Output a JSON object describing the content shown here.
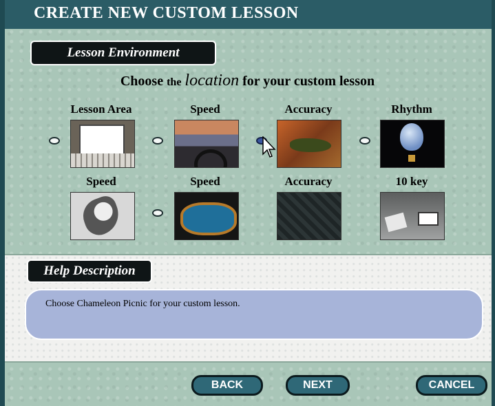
{
  "window": {
    "title": "CREATE NEW CUSTOM LESSON"
  },
  "lesson_environment": {
    "section_label": "Lesson Environment",
    "prompt": {
      "before": "Choose",
      "small": "the",
      "emphasis": "location",
      "after": "for your custom lesson"
    },
    "options": [
      {
        "label": "Lesson Area",
        "thumbnail": "classroom-computer",
        "radio": true,
        "selected": false
      },
      {
        "label": "Speed",
        "thumbnail": "car-dashboard-road",
        "radio": true,
        "selected": false
      },
      {
        "label": "Accuracy",
        "thumbnail": "chameleon-picnic",
        "radio": true,
        "selected": true
      },
      {
        "label": "Rhythm",
        "thumbnail": "hot-air-balloon",
        "radio": true,
        "selected": false
      },
      {
        "label": "Speed",
        "thumbnail": "penguin-sliding",
        "radio": false,
        "selected": false
      },
      {
        "label": "Speed",
        "thumbnail": "swimming-pool",
        "radio": true,
        "selected": false
      },
      {
        "label": "Accuracy",
        "thumbnail": "dark-pattern",
        "radio": false,
        "selected": false
      },
      {
        "label": "10 key",
        "thumbnail": "office-desk",
        "radio": false,
        "selected": false
      }
    ]
  },
  "help": {
    "section_label": "Help Description",
    "text": "Choose Chameleon Picnic for your custom lesson."
  },
  "buttons": {
    "back": "BACK",
    "next": "NEXT",
    "cancel": "CANCEL"
  },
  "colors": {
    "title_bar": "#2b5c66",
    "background": "#a9c6b8",
    "help_box": "#a7b4d9",
    "button": "#2f6877",
    "selected_radio": "#3a56a0"
  }
}
